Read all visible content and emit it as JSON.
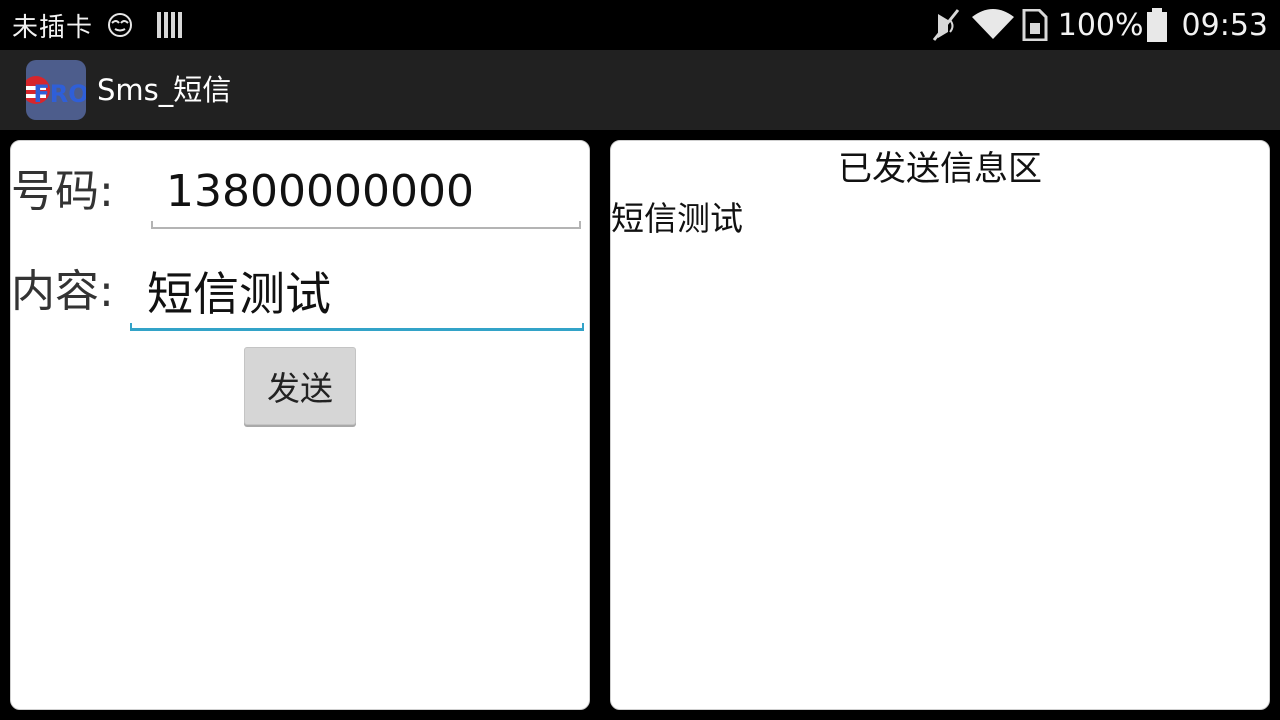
{
  "status_bar": {
    "carrier": "未插卡",
    "icons": [
      "face-icon",
      "signal-bars-icon",
      "mute-icon",
      "wifi-icon",
      "sim-card-icon",
      "battery-icon"
    ],
    "battery": "100%",
    "time": "09:53"
  },
  "action_bar": {
    "app_icon": "app-icon",
    "app_icon_text": "FRO",
    "title": "Sms_短信",
    "background": "#212121"
  },
  "form": {
    "number_label": "号码:",
    "number_value": "13800000000",
    "content_label": "内容:",
    "content_value": "短信测试",
    "send_label": "发送",
    "focus_color": "#33a3c8"
  },
  "sent_area": {
    "title": "已发送信息区",
    "messages": [
      "短信测试"
    ]
  }
}
